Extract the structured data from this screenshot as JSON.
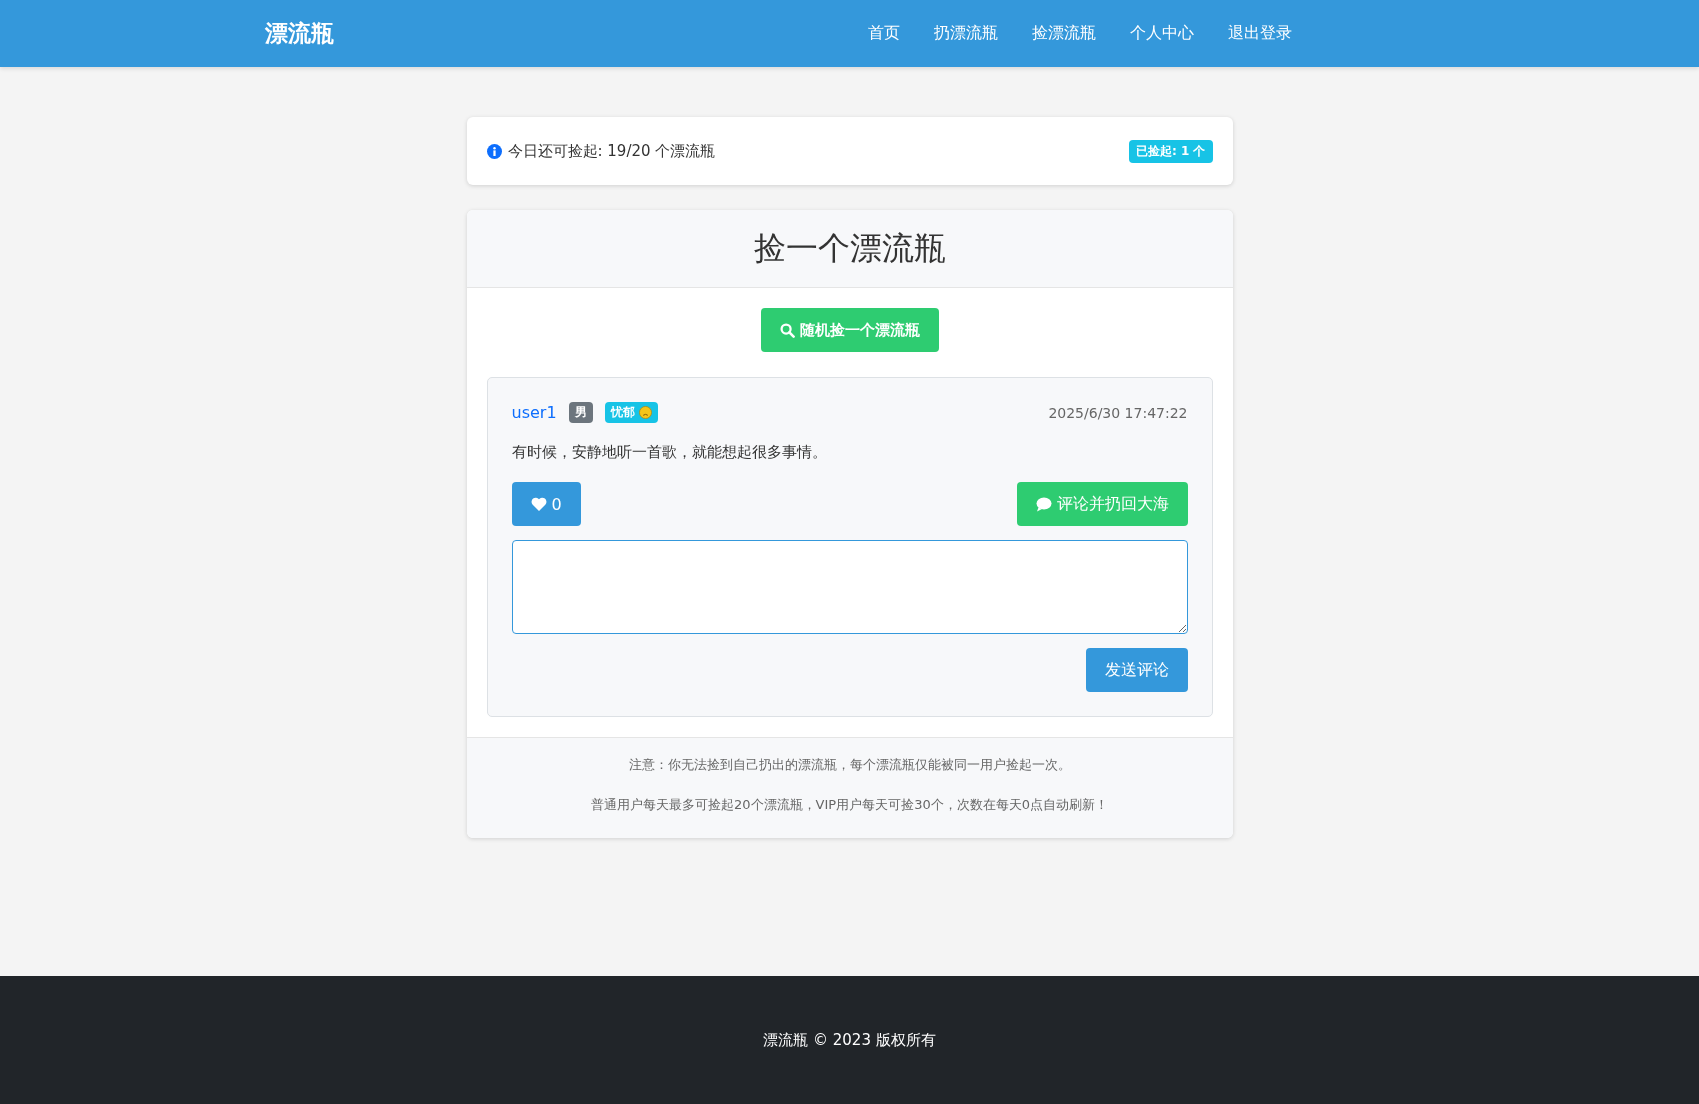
{
  "navbar": {
    "brand": "漂流瓶",
    "links": [
      "首页",
      "扔漂流瓶",
      "捡漂流瓶",
      "个人中心",
      "退出登录"
    ]
  },
  "quota": {
    "text": "今日还可捡起: 19/20 个漂流瓶",
    "badge": "已捡起: 1 个"
  },
  "pick": {
    "title": "捡一个漂流瓶",
    "button": "随机捡一个漂流瓶"
  },
  "bottle": {
    "user": "user1",
    "gender": "男",
    "mood": "忧郁",
    "time": "2025/6/30 17:47:22",
    "content": "有时候，安静地听一首歌，就能想起很多事情。",
    "likes": "0",
    "throw_back": "评论并扔回大海",
    "send": "发送评论"
  },
  "notes": [
    "注意：你无法捡到自己扔出的漂流瓶，每个漂流瓶仅能被同一用户捡起一次。",
    "普通用户每天最多可捡起20个漂流瓶，VIP用户每天可捡30个，次数在每天0点自动刷新！"
  ],
  "footer": "漂流瓶 © 2023 版权所有"
}
